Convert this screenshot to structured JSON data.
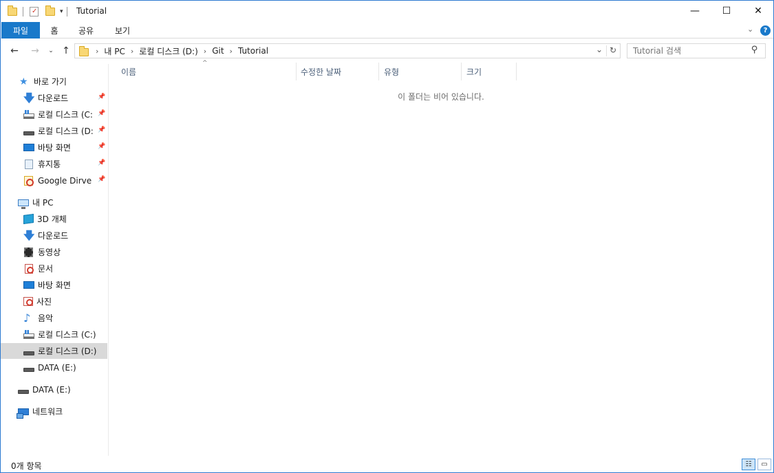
{
  "window": {
    "title": "Tutorial",
    "controls": {
      "minimize": "—",
      "maximize": "☐",
      "close": "✕"
    }
  },
  "ribbon": {
    "tabs": [
      {
        "label": "파일"
      },
      {
        "label": "홈"
      },
      {
        "label": "공유"
      },
      {
        "label": "보기"
      }
    ]
  },
  "address": {
    "path": [
      "내 PC",
      "로컬 디스크 (D:)",
      "Git",
      "Tutorial"
    ],
    "refresh_glyph": "↻",
    "dropdown_glyph": "⌄"
  },
  "search": {
    "placeholder": "Tutorial 검색",
    "icon_glyph": "⚲"
  },
  "sidebar": {
    "quick_access": {
      "label": "바로 가기"
    },
    "pinned": [
      {
        "label": "다운로드",
        "icon": "download-icon"
      },
      {
        "label": "로컬 디스크 (C:",
        "icon": "drive-c-icon"
      },
      {
        "label": "로컬 디스크 (D:",
        "icon": "drive-icon"
      },
      {
        "label": "바탕 화면",
        "icon": "desktop-icon"
      },
      {
        "label": "휴지통",
        "icon": "recycle-bin-icon"
      },
      {
        "label": "Google Dirve",
        "icon": "google-drive-icon"
      }
    ],
    "pin_glyph": "📌",
    "this_pc": {
      "label": "내 PC"
    },
    "pc_items": [
      {
        "label": "3D 개체",
        "icon": "3d-objects-icon"
      },
      {
        "label": "다운로드",
        "icon": "download-icon"
      },
      {
        "label": "동영상",
        "icon": "video-icon"
      },
      {
        "label": "문서",
        "icon": "documents-icon"
      },
      {
        "label": "바탕 화면",
        "icon": "desktop-icon"
      },
      {
        "label": "사진",
        "icon": "pictures-icon"
      },
      {
        "label": "음악",
        "icon": "music-icon"
      },
      {
        "label": "로컬 디스크 (C:)",
        "icon": "drive-c-icon"
      },
      {
        "label": "로컬 디스크 (D:)",
        "icon": "drive-icon",
        "selected": true
      },
      {
        "label": "DATA (E:)",
        "icon": "drive-icon"
      }
    ],
    "data_drive": {
      "label": "DATA (E:)"
    },
    "network": {
      "label": "네트워크"
    }
  },
  "columns": [
    {
      "label": "이름"
    },
    {
      "label": "수정한 날짜"
    },
    {
      "label": "유형"
    },
    {
      "label": "크기"
    }
  ],
  "content": {
    "empty_message": "이 폴더는 비어 있습니다."
  },
  "status": {
    "item_count": "0개 항목"
  },
  "colors": {
    "accent": "#1979ca",
    "selection": "#d9d9d9",
    "border": "#2b79d0"
  }
}
